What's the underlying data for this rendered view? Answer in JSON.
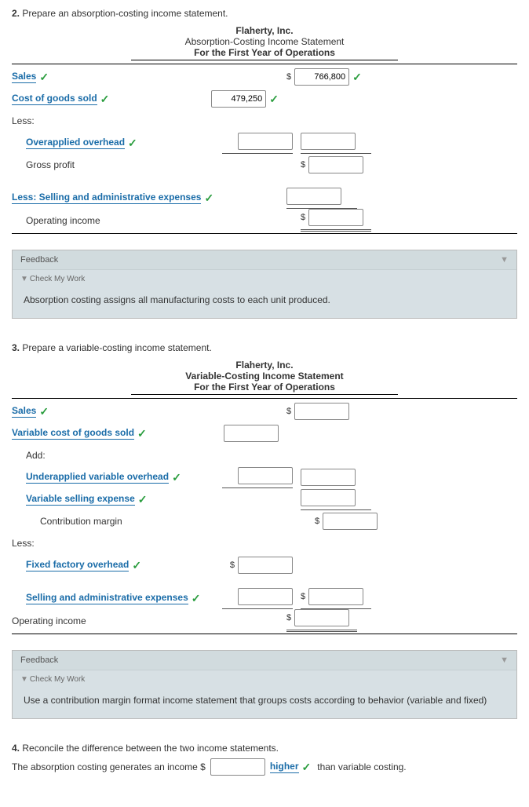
{
  "q2": {
    "prompt_num": "2.",
    "prompt_text": "Prepare an absorption-costing income statement.",
    "company": "Flaherty, Inc.",
    "title": "Absorption-Costing Income Statement",
    "period": "For the First Year of Operations",
    "lines": {
      "sales": "Sales",
      "cogs": "Cost of goods sold",
      "less": "Less:",
      "overapplied": "Overapplied overhead",
      "gross_profit": "Gross profit",
      "less_sga": "Less: Selling and administrative expenses",
      "op_income": "Operating income"
    },
    "values": {
      "sales": "766,800",
      "cogs": "479,250"
    },
    "feedback": {
      "head": "Feedback",
      "toggle": "Check My Work",
      "body": "Absorption costing assigns all manufacturing costs to each unit produced."
    }
  },
  "q3": {
    "prompt_num": "3.",
    "prompt_text": "Prepare a variable-costing income statement.",
    "company": "Flaherty, Inc.",
    "title": "Variable-Costing Income Statement",
    "period": "For the First Year of Operations",
    "lines": {
      "sales": "Sales",
      "vcogs": "Variable cost of goods sold",
      "add": "Add:",
      "under_var_oh": "Underapplied variable overhead",
      "var_sell_exp": "Variable selling expense",
      "contrib": "Contribution margin",
      "less": "Less:",
      "fixed_foh": "Fixed factory overhead",
      "sga": "Selling and administrative expenses",
      "op_income": "Operating income"
    },
    "feedback": {
      "head": "Feedback",
      "toggle": "Check My Work",
      "body": "Use a contribution margin format income statement that groups costs according to behavior (variable and fixed)"
    }
  },
  "q4": {
    "prompt_num": "4.",
    "prompt_text": "Reconcile the difference between the two income statements.",
    "sentence_a": "The absorption costing generates an income $",
    "answer": "higher",
    "sentence_b": "than variable costing."
  },
  "currency": "$"
}
